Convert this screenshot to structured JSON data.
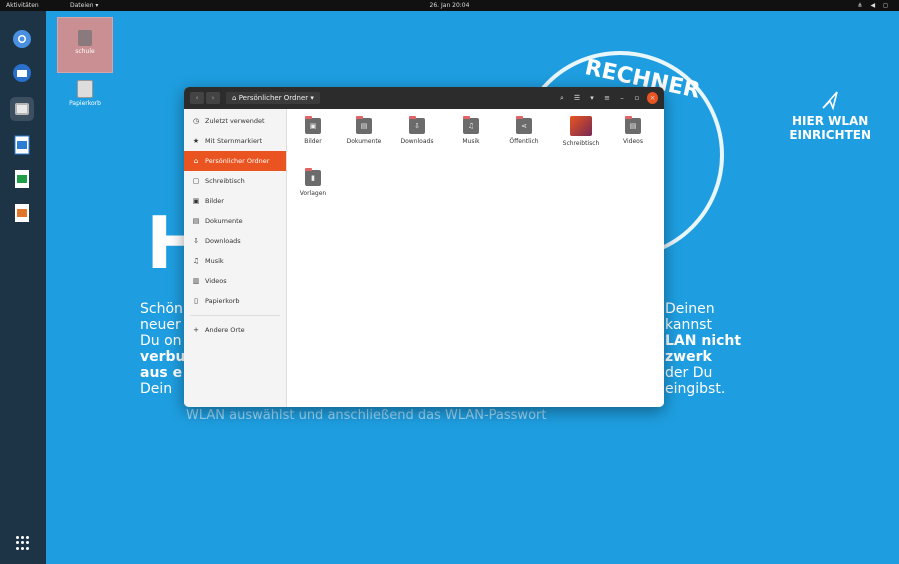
{
  "topbar": {
    "activities": "Aktivitäten",
    "files_menu": "Dateien ▾",
    "clock": "26. Jan 20:04",
    "tray": "⋔ ◀ ◻"
  },
  "dock": {
    "apps": [
      "chromium",
      "thunderbird",
      "files",
      "writer",
      "calc",
      "impress"
    ]
  },
  "desktop": {
    "icons": [
      {
        "label": "schule"
      },
      {
        "label": "Papierkorb"
      }
    ]
  },
  "wallpaper": {
    "big_letter": "H",
    "stamp_text": "RECHNER",
    "wlan_line1": "HIER WLAN",
    "wlan_line2": "EINRICHTEN",
    "text_left": [
      "Schön",
      "neuer",
      "Du on",
      "verbu",
      "aus e",
      "Dein"
    ],
    "text_right": [
      "Deinen",
      "kannst",
      "LAN nicht",
      "zwerk",
      "der Du",
      "eingibst."
    ],
    "bottom_line": "WLAN auswählst und anschließend das WLAN-Passwort"
  },
  "file_manager": {
    "path": "Persönlicher Ordner",
    "sidebar": [
      {
        "icon": "clock-icon",
        "label": "Zuletzt verwendet"
      },
      {
        "icon": "star-icon",
        "label": "Mit Sternmarkiert"
      },
      {
        "icon": "home-icon",
        "label": "Persönlicher Ordner",
        "active": true
      },
      {
        "icon": "desktop-icon",
        "label": "Schreibtisch"
      },
      {
        "icon": "image-icon",
        "label": "Bilder"
      },
      {
        "icon": "document-icon",
        "label": "Dokumente"
      },
      {
        "icon": "download-icon",
        "label": "Downloads"
      },
      {
        "icon": "music-icon",
        "label": "Musik"
      },
      {
        "icon": "video-icon",
        "label": "Videos"
      },
      {
        "icon": "trash-icon",
        "label": "Papierkorb"
      },
      {
        "icon": "plus-icon",
        "label": "Andere Orte"
      }
    ],
    "folders": [
      {
        "label": "Bilder",
        "glyph": "▣"
      },
      {
        "label": "Dokumente",
        "glyph": "▤"
      },
      {
        "label": "Downloads",
        "glyph": "⇩"
      },
      {
        "label": "Musik",
        "glyph": "♫"
      },
      {
        "label": "Öffentlich",
        "glyph": "⋖"
      },
      {
        "label": "Schreibtisch",
        "glyph": ""
      },
      {
        "label": "Videos",
        "glyph": "▤"
      },
      {
        "label": "Vorlagen",
        "glyph": "▮"
      }
    ]
  }
}
